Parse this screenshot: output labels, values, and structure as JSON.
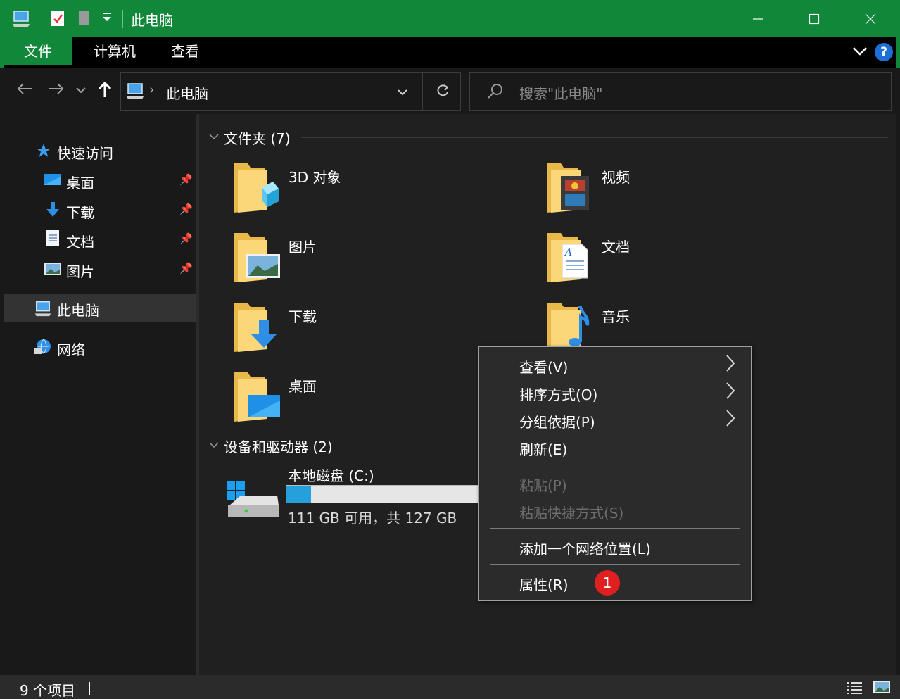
{
  "window": {
    "title": "此电脑",
    "colors": {
      "accent": "#11873a",
      "background": "#191919",
      "content": "#202020",
      "badge": "#e02020"
    }
  },
  "ribbon": {
    "tabs": [
      "文件",
      "计算机",
      "查看"
    ],
    "help_label": "?"
  },
  "address": {
    "path": "此电脑",
    "search_placeholder": "搜索\"此电脑\""
  },
  "sidebar": {
    "quick_access": "快速访问",
    "pinned": [
      "桌面",
      "下载",
      "文档",
      "图片"
    ],
    "this_pc": "此电脑",
    "network": "网络"
  },
  "content": {
    "folders_header": "文件夹 (7)",
    "folders": [
      "3D 对象",
      "视频",
      "图片",
      "文档",
      "下载",
      "音乐",
      "桌面"
    ],
    "devices_header": "设备和驱动器 (2)",
    "drive": {
      "name": "本地磁盘 (C:)",
      "free_text": "111 GB 可用，共 127 GB",
      "used_fraction": 0.126
    }
  },
  "context_menu": {
    "items": [
      {
        "label": "查看(V)",
        "submenu": true,
        "enabled": true
      },
      {
        "label": "排序方式(O)",
        "submenu": true,
        "enabled": true
      },
      {
        "label": "分组依据(P)",
        "submenu": true,
        "enabled": true
      },
      {
        "label": "刷新(E)",
        "submenu": false,
        "enabled": true
      },
      {
        "label": "粘贴(P)",
        "submenu": false,
        "enabled": false
      },
      {
        "label": "粘贴快捷方式(S)",
        "submenu": false,
        "enabled": false
      },
      {
        "label": "添加一个网络位置(L)",
        "submenu": false,
        "enabled": true
      },
      {
        "label": "属性(R)",
        "submenu": false,
        "enabled": true
      }
    ],
    "step_badge": "1"
  },
  "status": {
    "count": "9 个项目"
  }
}
